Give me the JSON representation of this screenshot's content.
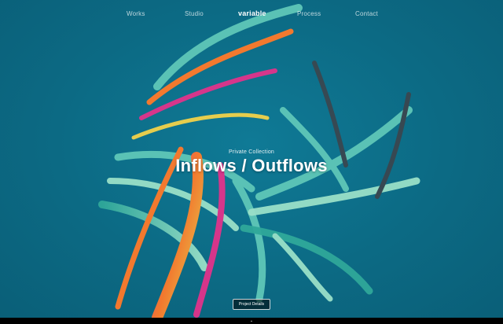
{
  "nav": {
    "items": [
      {
        "label": "Works"
      },
      {
        "label": "Studio"
      },
      {
        "label": "Process"
      },
      {
        "label": "Contact"
      }
    ],
    "logo": "variable"
  },
  "hero": {
    "eyebrow": "Private Collection",
    "title": "Inflows / Outflows",
    "cta_label": "Project Details",
    "artwork_icon": "abstract-sculpture"
  },
  "footer": {
    "scroll_icon": "chevron-down-icon",
    "scroll_glyph": "⌄"
  },
  "colors": {
    "background": "#0d6a86",
    "teal": "#5fc7b8",
    "orange": "#ff7a2a",
    "magenta": "#e0338b",
    "yellow": "#f2d24a",
    "dark": "#3a4750"
  }
}
